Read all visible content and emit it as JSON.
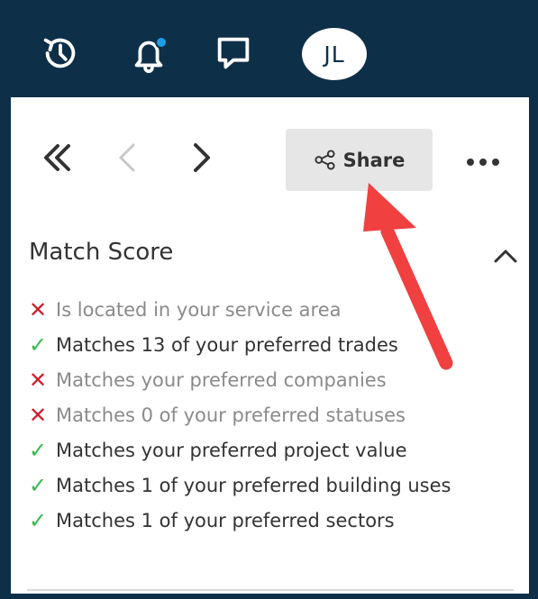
{
  "header": {
    "icons": [
      "history-icon",
      "bell-icon",
      "chat-icon"
    ],
    "notification_indicator_color": "#1f9ee8",
    "avatar_initials": "JL"
  },
  "toolbar": {
    "share_label": "Share",
    "icons": [
      "double-chevron-left-icon",
      "chevron-left-icon",
      "chevron-right-icon",
      "share-icon",
      "more-icon"
    ]
  },
  "match_score": {
    "title": "Match Score",
    "criteria": [
      {
        "status": "fail",
        "label": "Is located in your service area"
      },
      {
        "status": "pass",
        "label": "Matches 13 of your preferred trades"
      },
      {
        "status": "fail",
        "label": "Matches your preferred companies"
      },
      {
        "status": "fail",
        "label": "Matches 0 of your preferred statuses"
      },
      {
        "status": "pass",
        "label": "Matches your preferred project value"
      },
      {
        "status": "pass",
        "label": "Matches 1 of your preferred building uses"
      },
      {
        "status": "pass",
        "label": "Matches 1 of your preferred sectors"
      }
    ],
    "status_symbols": {
      "fail": "✕",
      "pass": "✓"
    }
  },
  "colors": {
    "header_bg": "#0e2f48",
    "fail": "#cc1f2d",
    "pass": "#36b94e",
    "annotation_arrow": "#f04040"
  },
  "annotation": {
    "type": "arrow",
    "points_to": "share-button"
  }
}
